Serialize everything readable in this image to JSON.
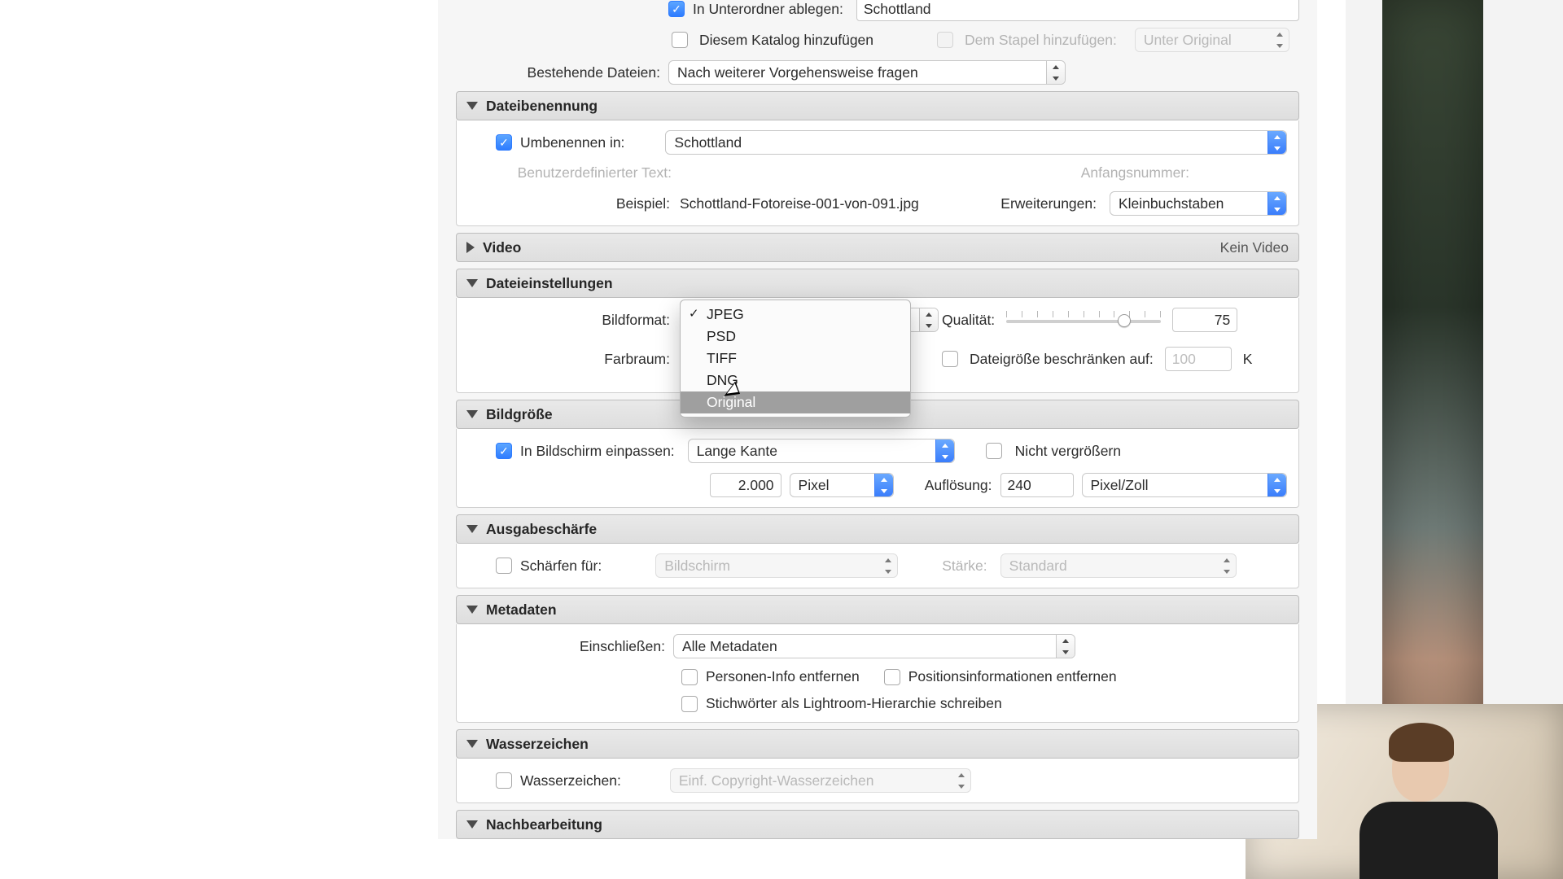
{
  "top": {
    "subfolder_label": "In Unterordner ablegen:",
    "subfolder_value": "Schottland",
    "add_catalog_label": "Diesem Katalog hinzufügen",
    "add_stack_label": "Dem Stapel hinzufügen:",
    "stack_pos": "Unter Original",
    "existing_label": "Bestehende Dateien:",
    "existing_value": "Nach weiterer Vorgehensweise fragen"
  },
  "naming": {
    "title": "Dateibenennung",
    "rename_label": "Umbenennen in:",
    "rename_value": "Schottland",
    "custom_text_label": "Benutzerdefinierter Text:",
    "start_num_label": "Anfangsnummer:",
    "example_label": "Beispiel:",
    "example_value": "Schottland-Fotoreise-001-von-091.jpg",
    "ext_label": "Erweiterungen:",
    "ext_value": "Kleinbuchstaben"
  },
  "video": {
    "title": "Video",
    "status": "Kein Video"
  },
  "filesettings": {
    "title": "Dateieinstellungen",
    "format_label": "Bildformat:",
    "format_options": [
      "JPEG",
      "PSD",
      "TIFF",
      "DNG",
      "Original"
    ],
    "format_selected": "JPEG",
    "format_hover": "Original",
    "colorspace_label": "Farbraum:",
    "quality_label": "Qualität:",
    "quality_value": "75",
    "limit_label": "Dateigröße beschränken auf:",
    "limit_placeholder": "100",
    "limit_unit": "K"
  },
  "sizing": {
    "title": "Bildgröße",
    "fit_label": "In Bildschirm einpassen:",
    "fit_value": "Lange Kante",
    "no_enlarge_label": "Nicht vergrößern",
    "dim_value": "2.000",
    "dim_unit": "Pixel",
    "res_label": "Auflösung:",
    "res_value": "240",
    "res_unit": "Pixel/Zoll"
  },
  "sharpen": {
    "title": "Ausgabeschärfe",
    "for_label": "Schärfen für:",
    "for_value": "Bildschirm",
    "amount_label": "Stärke:",
    "amount_value": "Standard"
  },
  "metadata": {
    "title": "Metadaten",
    "include_label": "Einschließen:",
    "include_value": "Alle Metadaten",
    "remove_person_label": "Personen-Info entfernen",
    "remove_location_label": "Positionsinformationen entfernen",
    "keywords_label": "Stichwörter als Lightroom-Hierarchie schreiben"
  },
  "watermark": {
    "title": "Wasserzeichen",
    "checkbox_label": "Wasserzeichen:",
    "value": "Einf. Copyright-Wasserzeichen"
  },
  "post": {
    "title": "Nachbearbeitung"
  }
}
